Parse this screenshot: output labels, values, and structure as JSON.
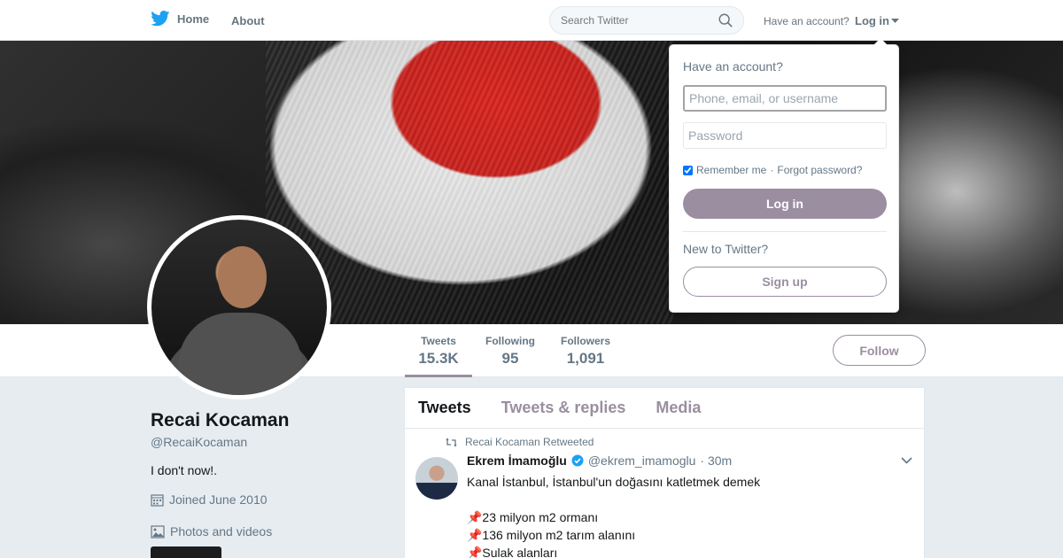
{
  "nav": {
    "home_label": "Home",
    "about_label": "About",
    "search_placeholder": "Search Twitter",
    "have_account": "Have an account?",
    "login_label": "Log in",
    "brand_color": "#1da1f2",
    "icons": {
      "logo": "twitter-bird-icon",
      "search": "search-icon",
      "caret": "caret-down-icon"
    }
  },
  "login_dropdown": {
    "title": "Have an account?",
    "username_placeholder": "Phone, email, or username",
    "password_placeholder": "Password",
    "remember_me": "Remember me",
    "separator": "·",
    "forgot_password": "Forgot password?",
    "login_button": "Log in",
    "new_to_twitter": "New to Twitter?",
    "signup_button": "Sign up",
    "accent_color": "#9b8ea1"
  },
  "profile": {
    "name": "Recai Kocaman",
    "handle": "@RecaiKocaman",
    "bio": "I don't now!.",
    "joined": "Joined June 2010",
    "photos_label": "Photos and videos",
    "stats": [
      {
        "label": "Tweets",
        "value": "15.3K"
      },
      {
        "label": "Following",
        "value": "95"
      },
      {
        "label": "Followers",
        "value": "1,091"
      }
    ],
    "follow_button": "Follow"
  },
  "timeline": {
    "tabs": [
      "Tweets",
      "Tweets & replies",
      "Media"
    ],
    "tweet": {
      "retweeted_by": "Recai Kocaman Retweeted",
      "author_name": "Ekrem İmamoğlu",
      "author_handle": "@ekrem_imamoglu",
      "time": "· 30m",
      "text": "Kanal İstanbul, İstanbul'un doğasını katletmek demek\n\n📌23 milyon m2 ormanı\n📌136 milyon m2 tarım alanını\n📌Sulak alanları",
      "icons": {
        "retweet": "retweet-icon",
        "verified": "verified-badge-icon",
        "more": "chevron-down-icon"
      }
    }
  }
}
